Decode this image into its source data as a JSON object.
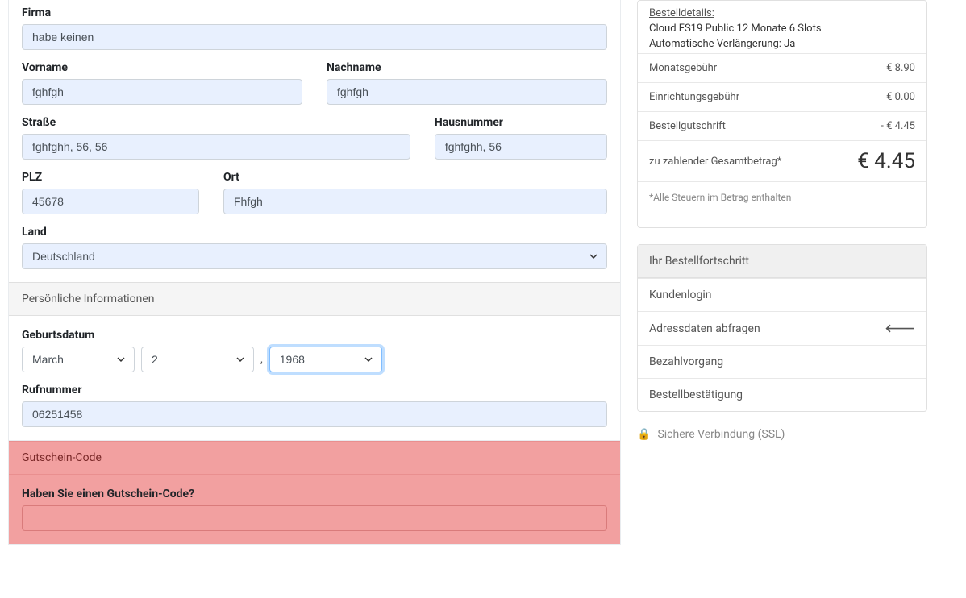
{
  "address": {
    "firma_label": "Firma",
    "firma_value": "habe keinen",
    "vorname_label": "Vorname",
    "vorname_value": "fghfgh",
    "nachname_label": "Nachname",
    "nachname_value": "fghfgh",
    "strasse_label": "Straße",
    "strasse_value": "fghfghh, 56, 56",
    "hausnummer_label": "Hausnummer",
    "hausnummer_value": "fghfghh, 56",
    "plz_label": "PLZ",
    "plz_value": "45678",
    "ort_label": "Ort",
    "ort_value": "Fhfgh",
    "land_label": "Land",
    "land_value": "Deutschland"
  },
  "personal": {
    "section_title": "Persönliche Informationen",
    "geburtsdatum_label": "Geburtsdatum",
    "month_value": "March",
    "day_value": "2",
    "year_value": "1968",
    "dob_comma": ",",
    "rufnummer_label": "Rufnummer",
    "rufnummer_value": "06251458"
  },
  "coupon": {
    "section_title": "Gutschein-Code",
    "question": "Haben Sie einen Gutschein-Code?",
    "value": ""
  },
  "summary": {
    "details_link": "Bestelldetails:",
    "product_line": "Cloud FS19 Public 12 Monate 6 Slots",
    "renewal_line": "Automatische Verlängerung: Ja",
    "rows": [
      {
        "label": "Monatsgebühr",
        "value": "€ 8.90"
      },
      {
        "label": "Einrichtungsgebühr",
        "value": "€ 0.00"
      },
      {
        "label": "Bestellgutschrift",
        "value": "- € 4.45"
      }
    ],
    "total_label": "zu zahlender Gesamtbetrag*",
    "total_value": "€ 4.45",
    "tax_note": "*Alle Steuern im Betrag enthalten"
  },
  "progress": {
    "header": "Ihr Bestellfortschritt",
    "items": [
      {
        "label": "Kundenlogin",
        "current": false
      },
      {
        "label": "Adressdaten abfragen",
        "current": true
      },
      {
        "label": "Bezahlvorgang",
        "current": false
      },
      {
        "label": "Bestellbestätigung",
        "current": false
      }
    ]
  },
  "ssl": {
    "text": "Sichere Verbindung (SSL)"
  }
}
